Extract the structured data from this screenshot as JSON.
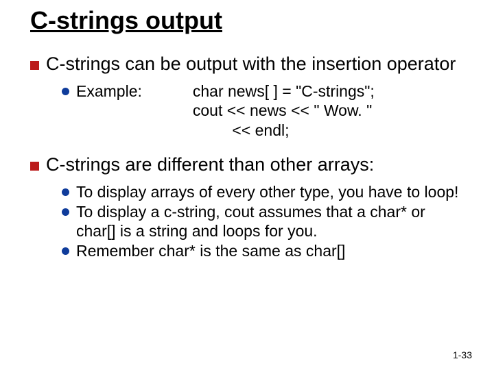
{
  "title": "C-strings output",
  "bullets": {
    "b1": "C-strings can be output with the insertion operator",
    "b1_sub": {
      "label": "Example:",
      "code1": "char news[ ] = \"C-strings\";",
      "code2": "cout << news << \" Wow. \"",
      "code3": "         << endl;"
    },
    "b2": "C-strings are different than other arrays:",
    "b2_subs": {
      "s1": "To display arrays of every other type, you have to loop!",
      "s2": "To display a c-string, cout assumes that a char* or char[] is a string and loops for you.",
      "s3": "Remember char* is the same as char[]"
    }
  },
  "footer": "1-33"
}
